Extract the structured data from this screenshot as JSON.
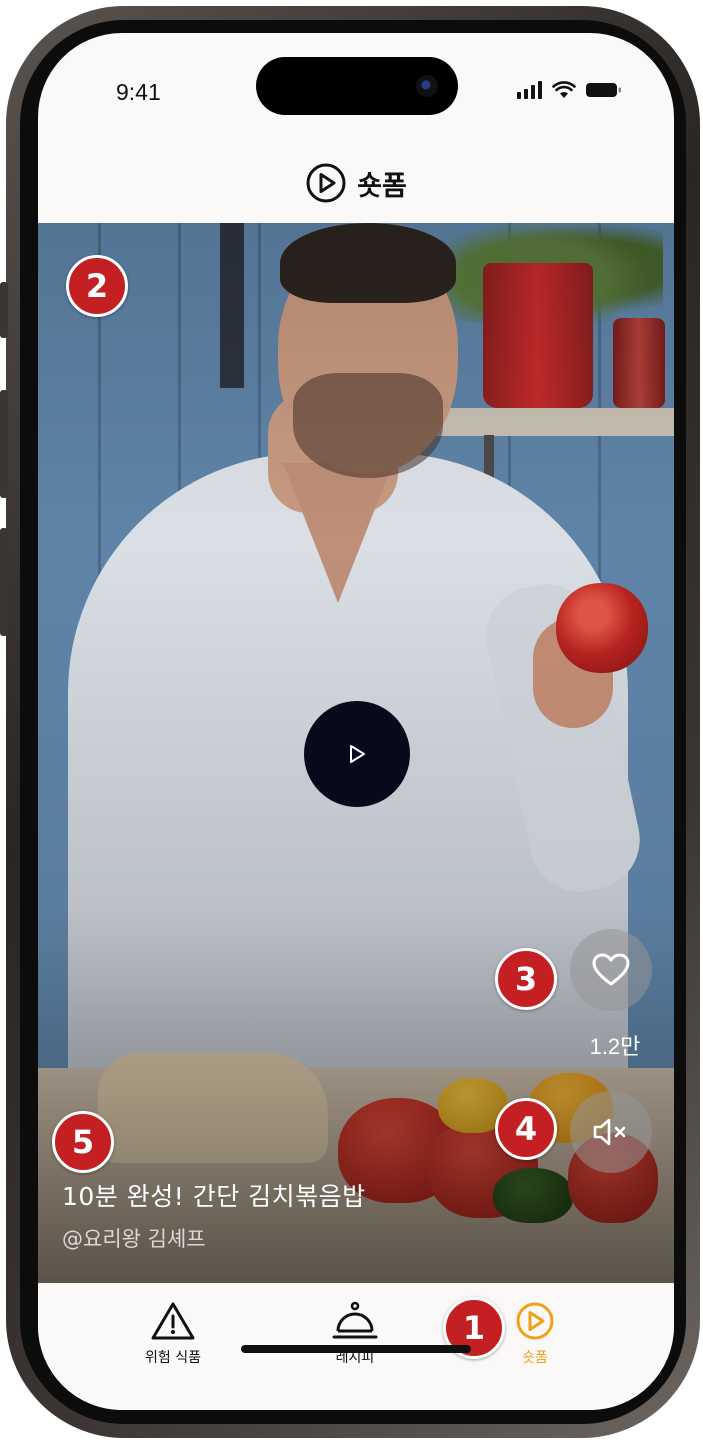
{
  "status_bar": {
    "time": "9:41"
  },
  "header": {
    "title": "숏폼",
    "icon": "play-circle-icon"
  },
  "video": {
    "title": "10분 완성! 간단 김치볶음밥",
    "author": "@요리왕 김셰프",
    "like_count": "1.2만",
    "play_icon": "play-icon",
    "like_icon": "heart-icon",
    "mute_icon": "speaker-mute-icon"
  },
  "annotations": [
    "1",
    "2",
    "3",
    "4",
    "5"
  ],
  "tabbar": {
    "items": [
      {
        "label": "위험 식품",
        "icon": "warning-triangle-icon"
      },
      {
        "label": "레시피",
        "icon": "cloche-icon"
      },
      {
        "label": "숏폼",
        "icon": "play-circle-icon"
      }
    ],
    "active_color": "#f0a01a"
  },
  "colors": {
    "badge": "#c41f23",
    "active_tab": "#f0a01a",
    "play_button": "#080a1c"
  }
}
